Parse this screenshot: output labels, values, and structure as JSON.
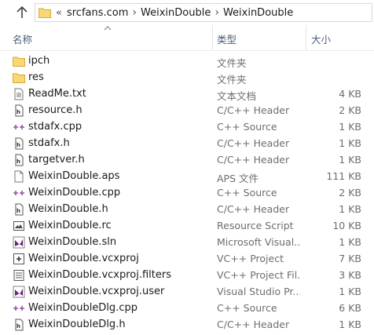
{
  "address": {
    "overflow": "«",
    "crumbs": [
      "srcfans.com",
      "WeixinDouble",
      "WeixinDouble"
    ]
  },
  "columns": {
    "name": "名称",
    "type": "类型",
    "size": "大小"
  },
  "files": [
    {
      "name": "ipch",
      "type": "文件夹",
      "size": "",
      "icon": "folder-icon"
    },
    {
      "name": "res",
      "type": "文件夹",
      "size": "",
      "icon": "folder-icon"
    },
    {
      "name": "ReadMe.txt",
      "type": "文本文档",
      "size": "4 KB",
      "icon": "text-file-icon"
    },
    {
      "name": "resource.h",
      "type": "C/C++ Header",
      "size": "2 KB",
      "icon": "header-file-icon"
    },
    {
      "name": "stdafx.cpp",
      "type": "C++ Source",
      "size": "1 KB",
      "icon": "cpp-file-icon"
    },
    {
      "name": "stdafx.h",
      "type": "C/C++ Header",
      "size": "1 KB",
      "icon": "header-file-icon"
    },
    {
      "name": "targetver.h",
      "type": "C/C++ Header",
      "size": "1 KB",
      "icon": "header-file-icon"
    },
    {
      "name": "WeixinDouble.aps",
      "type": "APS 文件",
      "size": "111 KB",
      "icon": "blank-file-icon"
    },
    {
      "name": "WeixinDouble.cpp",
      "type": "C++ Source",
      "size": "2 KB",
      "icon": "cpp-file-icon"
    },
    {
      "name": "WeixinDouble.h",
      "type": "C/C++ Header",
      "size": "1 KB",
      "icon": "header-file-icon"
    },
    {
      "name": "WeixinDouble.rc",
      "type": "Resource Script",
      "size": "10 KB",
      "icon": "resource-file-icon"
    },
    {
      "name": "WeixinDouble.sln",
      "type": "Microsoft Visual...",
      "size": "1 KB",
      "icon": "solution-file-icon"
    },
    {
      "name": "WeixinDouble.vcxproj",
      "type": "VC++ Project",
      "size": "7 KB",
      "icon": "vcxproj-file-icon"
    },
    {
      "name": "WeixinDouble.vcxproj.filters",
      "type": "VC++ Project Fil...",
      "size": "3 KB",
      "icon": "filters-file-icon"
    },
    {
      "name": "WeixinDouble.vcxproj.user",
      "type": "Visual Studio Pr...",
      "size": "1 KB",
      "icon": "user-file-icon"
    },
    {
      "name": "WeixinDoubleDlg.cpp",
      "type": "C++ Source",
      "size": "6 KB",
      "icon": "cpp-file-icon"
    },
    {
      "name": "WeixinDoubleDlg.h",
      "type": "C/C++ Header",
      "size": "1 KB",
      "icon": "header-file-icon"
    }
  ]
}
